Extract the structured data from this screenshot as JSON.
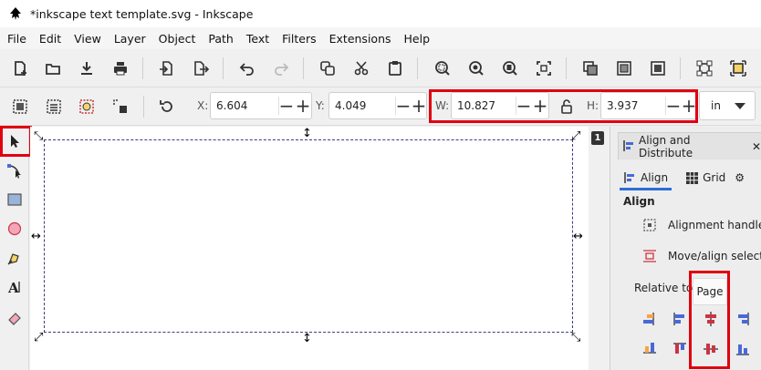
{
  "window": {
    "title": "*inkscape text template.svg - Inkscape"
  },
  "menu": [
    "File",
    "Edit",
    "View",
    "Layer",
    "Object",
    "Path",
    "Text",
    "Filters",
    "Extensions",
    "Help"
  ],
  "commands": [
    "new-document-icon",
    "open-icon",
    "import-icon",
    "print-icon",
    "import-file-icon",
    "export-icon",
    "undo-icon",
    "redo-icon",
    "duplicate-icon",
    "cut-icon",
    "paste-icon",
    "zoom-selection-icon",
    "zoom-drawing-icon",
    "zoom-page-icon",
    "zoom-fit-icon",
    "group-icon",
    "ungroup-icon",
    "clone-icon",
    "node-snap-icon",
    "snap-bbox-icon"
  ],
  "controls": {
    "x_label": "X:",
    "x_value": "6.604",
    "y_label": "Y:",
    "y_value": "4.049",
    "w_label": "W:",
    "w_value": "10.827",
    "h_label": "H:",
    "h_value": "3.937",
    "unit": "in"
  },
  "page_number": "1",
  "dock": {
    "tab_title": "Align and Distribute",
    "subtabs": [
      "Align",
      "Grid"
    ],
    "section": "Align",
    "rows": [
      "Alignment handles",
      "Move/align selectic"
    ],
    "relative_label": "Relative to:",
    "relative_value": "Page"
  },
  "colors": {
    "highlight": "#e00010",
    "accent": "#2a6fd6",
    "page_border": "#3a3a8c"
  }
}
